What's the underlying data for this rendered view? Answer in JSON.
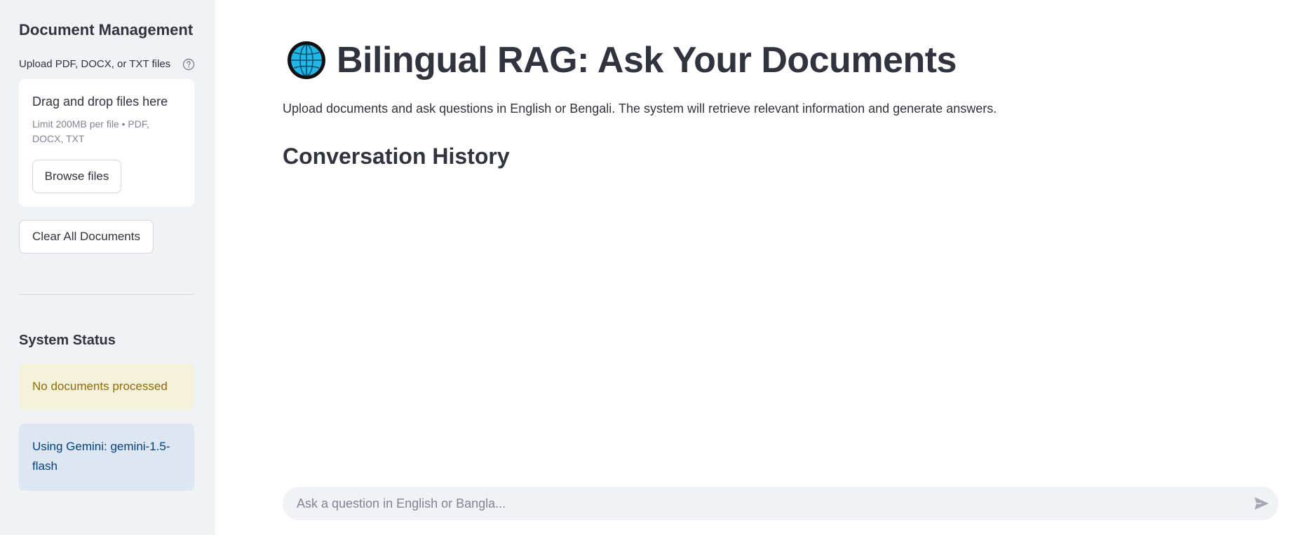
{
  "sidebar": {
    "title": "Document Management",
    "upload_label": "Upload PDF, DOCX, or TXT files",
    "help_icon": "question-circle-icon",
    "dropzone": {
      "title": "Drag and drop files here",
      "limit": "Limit 200MB per file • PDF, DOCX, TXT",
      "browse_label": "Browse files"
    },
    "clear_label": "Clear All Documents",
    "status_title": "System Status",
    "status_warning": "No documents processed",
    "status_info": "Using Gemini: gemini-1.5-flash"
  },
  "main": {
    "title_icon": "globe-icon",
    "title": "Bilingual RAG: Ask Your Documents",
    "subtitle": "Upload documents and ask questions in English or Bengali. The system will retrieve relevant information and generate answers.",
    "conversation_title": "Conversation History",
    "chat": {
      "placeholder": "Ask a question in English or Bangla...",
      "value": "",
      "send_icon": "send-icon"
    }
  },
  "colors": {
    "sidebar_bg": "#f0f2f6",
    "text": "#31333f",
    "muted": "#808495",
    "warning_bg": "#f4f1dc",
    "warning_text": "#926c05",
    "info_bg": "#dee6f1",
    "info_text": "#004280"
  }
}
